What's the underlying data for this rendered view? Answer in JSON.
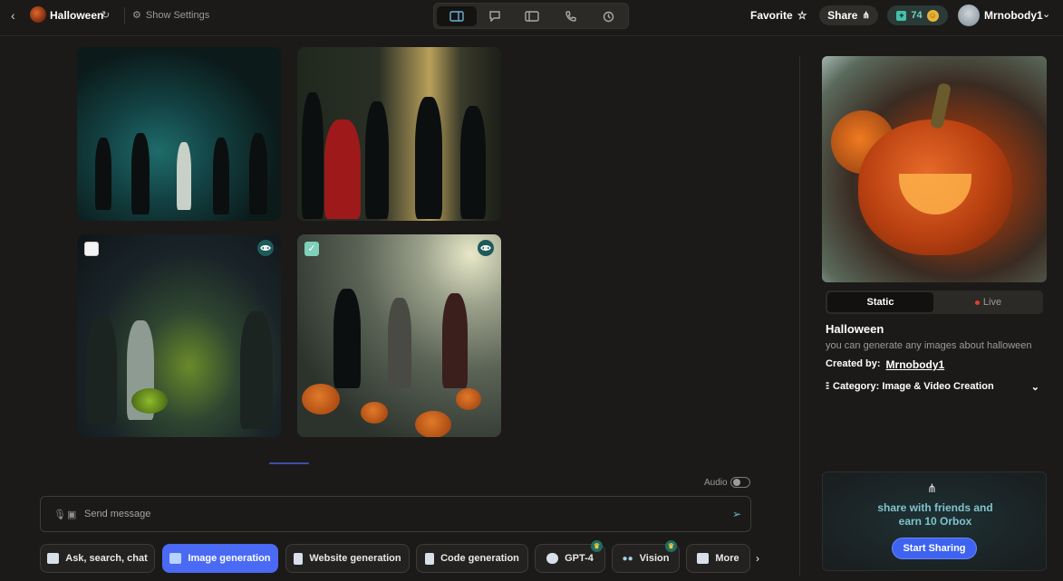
{
  "header": {
    "bot_name": "Halloween",
    "settings_label": "Show Settings",
    "favorite_label": "Favorite",
    "share_label": "Share",
    "credits": "74",
    "username": "Mrnobody1"
  },
  "composer": {
    "audio_label": "Audio",
    "placeholder": "Send message"
  },
  "tools": {
    "items": [
      {
        "label": "Ask, search, chat"
      },
      {
        "label": "Image generation"
      },
      {
        "label": "Website generation"
      },
      {
        "label": "Code generation"
      },
      {
        "label": "GPT-4"
      },
      {
        "label": "Vision"
      },
      {
        "label": "More"
      }
    ]
  },
  "sidebar": {
    "tab_static": "Static",
    "tab_live": "Live",
    "title": "Halloween",
    "description": "you can generate any images about halloween",
    "created_by_label": "Created by:",
    "creator": "Mrnobody1",
    "category": "Category: Image & Video Creation"
  },
  "promo": {
    "text_line1": "share with friends and",
    "text_line2": "earn 10 Orbox",
    "button": "Start Sharing"
  },
  "icons": {
    "back": "chevron-left-icon",
    "refresh": "refresh-icon",
    "settings": "gear-icon",
    "favorite": "star-icon",
    "share": "share-icon",
    "send": "send-icon"
  },
  "colors": {
    "accent": "#4a6af4",
    "teal": "#6ed3c0",
    "live": "#e53b2f"
  }
}
